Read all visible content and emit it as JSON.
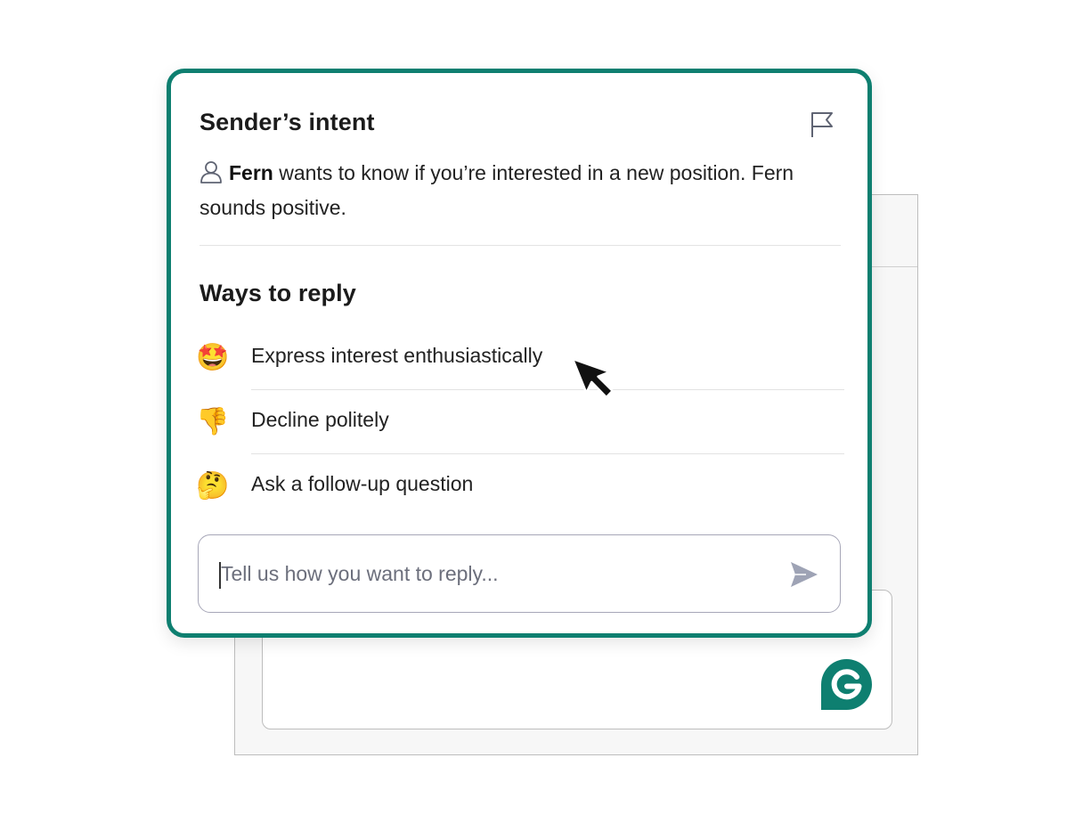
{
  "colors": {
    "brand": "#0e7f70",
    "border_gray": "#bdbdbd",
    "text": "#222222",
    "placeholder": "#6c6f7c",
    "send_icon": "#9ea3b5"
  },
  "card": {
    "intent_title": "Sender’s intent",
    "flag_icon": "flag-icon",
    "intent": {
      "user_icon": "user-icon",
      "sender_name": "Fern",
      "message": " wants to know if you’re interested in a new position. Fern sounds positive."
    },
    "ways_title": "Ways to reply",
    "options": [
      {
        "emoji": "🤩",
        "icon": "star-struck-emoji-icon",
        "label": "Express interest enthusiastically"
      },
      {
        "emoji": "👎",
        "icon": "thumbs-down-emoji-icon",
        "label": "Decline politely"
      },
      {
        "emoji": "🤔",
        "icon": "thinking-face-emoji-icon",
        "label": "Ask a follow-up question"
      }
    ],
    "input": {
      "placeholder": "Tell us how you want to reply...",
      "send_icon": "send-icon"
    }
  },
  "badge": {
    "icon": "grammarly-g-icon"
  }
}
